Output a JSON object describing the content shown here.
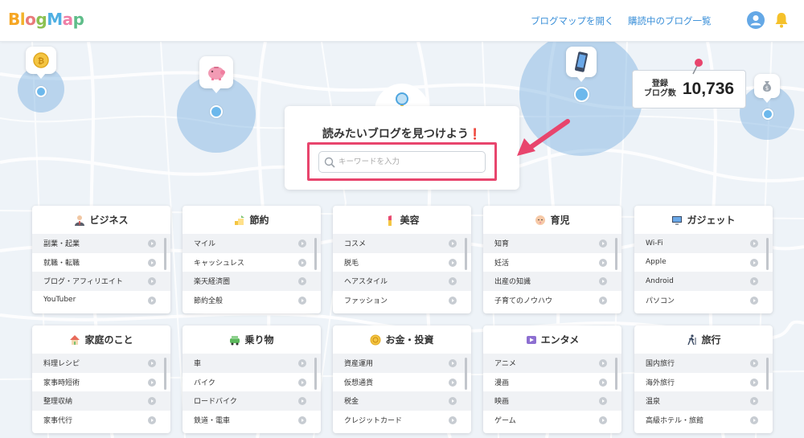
{
  "header": {
    "logo_letters": [
      "B",
      "l",
      "o",
      "g",
      "M",
      "a",
      "p"
    ],
    "logo_colors": [
      "#f6a623",
      "#f2b42b",
      "#e97a7a",
      "#8cc152",
      "#4fb0e3",
      "#ef7fa7",
      "#5ebd89"
    ],
    "nav_open_map": "ブログマップを開く",
    "nav_subscribed": "購読中のブログ一覧",
    "avatar_icon": "user-avatar-icon",
    "bell_icon": "bell-icon"
  },
  "counter": {
    "label_line1": "登録",
    "label_line2": "ブログ数",
    "value": "10,736"
  },
  "search": {
    "title": "読みたいブログを見つけよう",
    "exclaim": "❗",
    "placeholder": "キーワードを入力",
    "accent": "#e8456d"
  },
  "categories": [
    {
      "title": "ビジネス",
      "icon": "businessman-icon",
      "items": [
        "副業・起業",
        "就職・転職",
        "ブログ・アフィリエイト",
        "YouTuber"
      ]
    },
    {
      "title": "節約",
      "icon": "coins-icon",
      "items": [
        "マイル",
        "キャッシュレス",
        "楽天経済圏",
        "節約全般"
      ]
    },
    {
      "title": "美容",
      "icon": "lipstick-icon",
      "items": [
        "コスメ",
        "脱毛",
        "ヘアスタイル",
        "ファッション"
      ]
    },
    {
      "title": "育児",
      "icon": "baby-icon",
      "items": [
        "知育",
        "妊活",
        "出産の知識",
        "子育てのノウハウ"
      ]
    },
    {
      "title": "ガジェット",
      "icon": "computer-icon",
      "items": [
        "Wi-Fi",
        "Apple",
        "Android",
        "パソコン"
      ]
    },
    {
      "title": "家庭のこと",
      "icon": "house-icon",
      "items": [
        "料理レシピ",
        "家事時短術",
        "整理収納",
        "家事代行"
      ]
    },
    {
      "title": "乗り物",
      "icon": "car-icon",
      "items": [
        "車",
        "バイク",
        "ロードバイク",
        "鉄道・電車"
      ]
    },
    {
      "title": "お金・投資",
      "icon": "coin-icon",
      "items": [
        "資産運用",
        "仮想通貨",
        "税金",
        "クレジットカード"
      ]
    },
    {
      "title": "エンタメ",
      "icon": "video-icon",
      "items": [
        "アニメ",
        "漫画",
        "映画",
        "ゲーム"
      ]
    },
    {
      "title": "旅行",
      "icon": "walking-person-icon",
      "items": [
        "国内旅行",
        "海外旅行",
        "温泉",
        "高級ホテル・旅館"
      ]
    }
  ]
}
